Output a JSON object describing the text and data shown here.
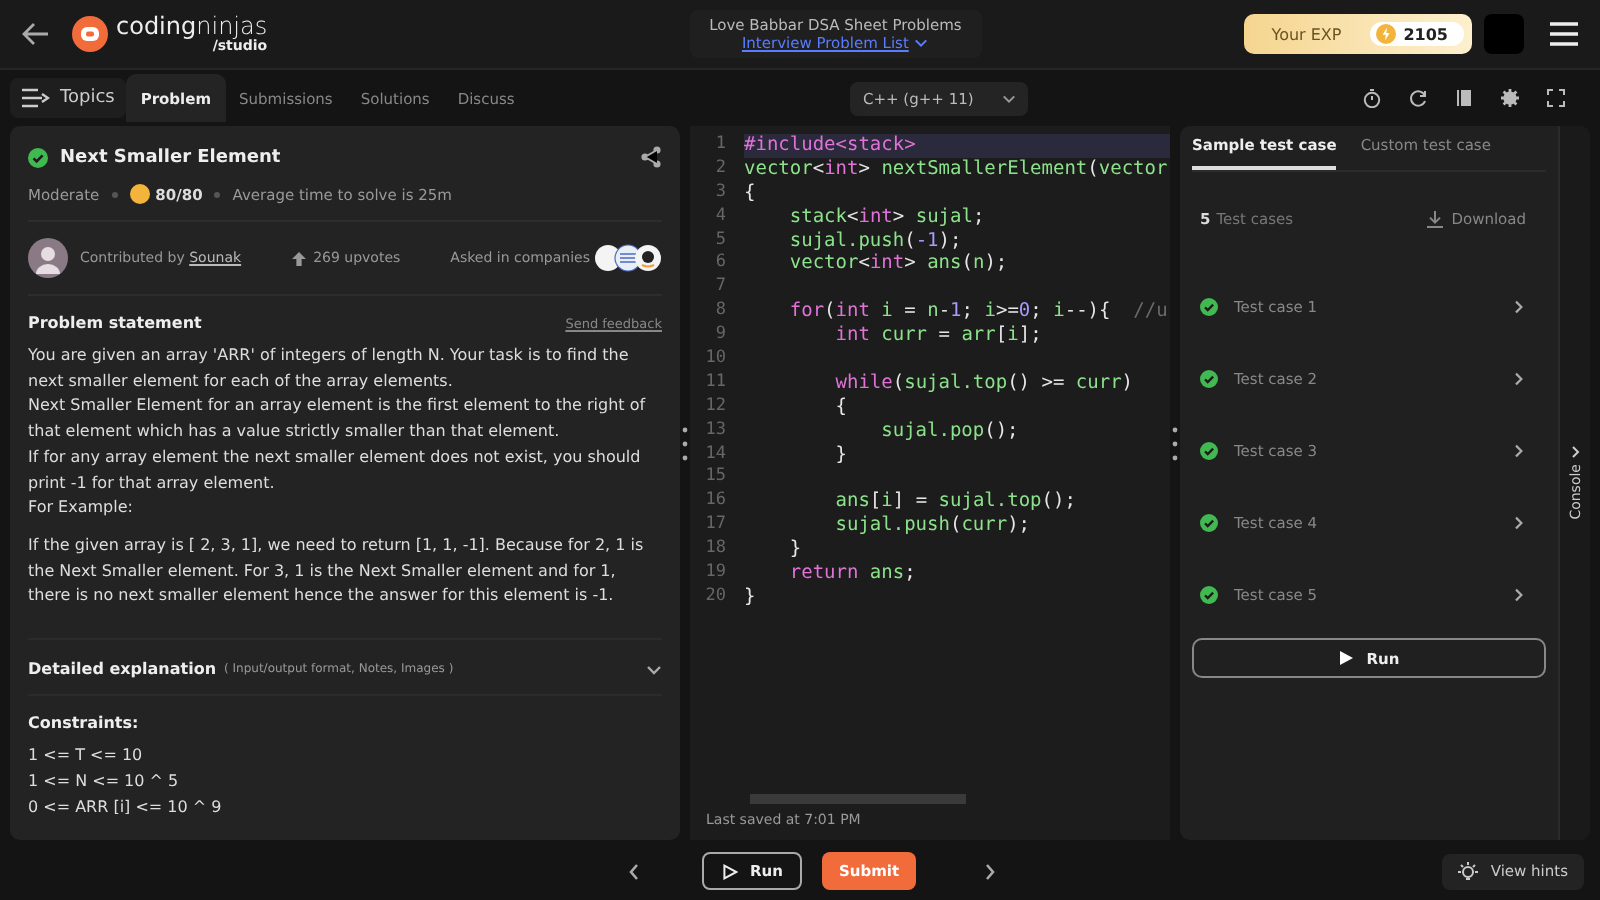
{
  "header": {
    "logo_text": "**coding**ninjas",
    "logo_sub": "/studio",
    "sheet_title": "Love Babbar DSA Sheet Problems",
    "sheet_link": "Interview Problem List",
    "exp_label": "Your EXP",
    "exp_value": "2105"
  },
  "topics_button": "Topics",
  "tabs": [
    {
      "label": "Problem",
      "selected": true
    },
    {
      "label": "Submissions",
      "selected": false
    },
    {
      "label": "Solutions",
      "selected": false
    },
    {
      "label": "Discuss",
      "selected": false
    }
  ],
  "language": "C++ (g++ 11)",
  "problem": {
    "solved": true,
    "title": "Next Smaller Element",
    "difficulty": "Moderate",
    "score": "80/80",
    "avg_time": "Average time to solve is 25m",
    "contributor_prefix": "Contributed by",
    "contributor": "Sounak",
    "upvotes": "269 upvotes",
    "companies_label": "Asked in companies",
    "statement_heading": "Problem statement",
    "feedback": "Send feedback",
    "paragraphs": [
      "You are given an array 'ARR' of integers of length N. Your task is to find the next smaller element for each of the array elements.",
      "Next Smaller Element for an array element is the first element to the right of that element which has a value strictly smaller than that element.",
      "If for any array element the next smaller element does not exist, you should print -1 for that array element.",
      "For Example:"
    ],
    "example": "If the given array is [ 2, 3, 1], we need to return [1, 1, -1]. Because for 2, 1 is the Next Smaller element. For 3, 1 is the Next Smaller element and for 1, there is no next smaller element hence the answer for this element is -1.",
    "explanation_heading": "Detailed explanation",
    "explanation_note": "( Input/output format, Notes, Images )",
    "constraints_heading": "Constraints:",
    "constraints": [
      "1 <= T <= 10",
      "1 <= N <= 10 ^ 5",
      "0 <= ARR [i] <= 10 ^ 9"
    ]
  },
  "code": [
    {
      "num": "1",
      "selected": true,
      "tokens": [
        {
          "kind": "keyword",
          "text": "#include<stack>"
        }
      ]
    },
    {
      "num": "2",
      "selected": false,
      "tokens": [
        {
          "kind": "ident",
          "text": "vector"
        },
        {
          "kind": "punct",
          "text": "<"
        },
        {
          "kind": "keyword",
          "text": "int"
        },
        {
          "kind": "punct",
          "text": "> "
        },
        {
          "kind": "ident",
          "text": "nextSmallerElement"
        },
        {
          "kind": "punct",
          "text": "("
        },
        {
          "kind": "ident",
          "text": "vector"
        }
      ]
    },
    {
      "num": "3",
      "selected": false,
      "tokens": [
        {
          "kind": "punct",
          "text": "{"
        }
      ]
    },
    {
      "num": "4",
      "selected": false,
      "tokens": [
        {
          "kind": "ident",
          "text": "    stack"
        },
        {
          "kind": "punct",
          "text": "<"
        },
        {
          "kind": "keyword",
          "text": "int"
        },
        {
          "kind": "punct",
          "text": "> "
        },
        {
          "kind": "ident",
          "text": "sujal"
        },
        {
          "kind": "punct",
          "text": ";"
        }
      ]
    },
    {
      "num": "5",
      "selected": false,
      "tokens": [
        {
          "kind": "ident",
          "text": "    sujal.push"
        },
        {
          "kind": "punct",
          "text": "("
        },
        {
          "kind": "number",
          "text": "-1"
        },
        {
          "kind": "punct",
          "text": ");"
        }
      ]
    },
    {
      "num": "6",
      "selected": false,
      "tokens": [
        {
          "kind": "ident",
          "text": "    vector"
        },
        {
          "kind": "punct",
          "text": "<"
        },
        {
          "kind": "keyword",
          "text": "int"
        },
        {
          "kind": "punct",
          "text": "> "
        },
        {
          "kind": "ident",
          "text": "ans"
        },
        {
          "kind": "punct",
          "text": "("
        },
        {
          "kind": "ident",
          "text": "n"
        },
        {
          "kind": "punct",
          "text": ");"
        }
      ]
    },
    {
      "num": "7",
      "selected": false
    },
    {
      "num": "8",
      "selected": false,
      "tokens": [
        {
          "kind": "keyword",
          "text": "    for"
        },
        {
          "kind": "punct",
          "text": "("
        },
        {
          "kind": "keyword",
          "text": "int"
        },
        {
          "kind": "ident",
          "text": " i "
        },
        {
          "kind": "punct",
          "text": "= "
        },
        {
          "kind": "ident",
          "text": "n"
        },
        {
          "kind": "punct",
          "text": "-"
        },
        {
          "kind": "number",
          "text": "1"
        },
        {
          "kind": "punct",
          "text": "; "
        },
        {
          "kind": "ident",
          "text": "i"
        },
        {
          "kind": "punct",
          "text": ">="
        },
        {
          "kind": "number",
          "text": "0"
        },
        {
          "kind": "punct",
          "text": "; "
        },
        {
          "kind": "ident",
          "text": "i"
        },
        {
          "kind": "punct",
          "text": "--){  "
        },
        {
          "kind": "comment",
          "text": "//u"
        }
      ]
    },
    {
      "num": "9",
      "selected": false,
      "tokens": [
        {
          "kind": "keyword",
          "text": "        int"
        },
        {
          "kind": "ident",
          "text": " curr "
        },
        {
          "kind": "punct",
          "text": "= "
        },
        {
          "kind": "ident",
          "text": "arr"
        },
        {
          "kind": "punct",
          "text": "["
        },
        {
          "kind": "ident",
          "text": "i"
        },
        {
          "kind": "punct",
          "text": "];"
        }
      ]
    },
    {
      "num": "10",
      "selected": false
    },
    {
      "num": "11",
      "selected": false,
      "tokens": [
        {
          "kind": "keyword",
          "text": "        while"
        },
        {
          "kind": "punct",
          "text": "("
        },
        {
          "kind": "ident",
          "text": "sujal.top"
        },
        {
          "kind": "punct",
          "text": "() >= "
        },
        {
          "kind": "ident",
          "text": "curr"
        },
        {
          "kind": "punct",
          "text": ")"
        }
      ]
    },
    {
      "num": "12",
      "selected": false,
      "tokens": [
        {
          "kind": "punct",
          "text": "        {"
        }
      ]
    },
    {
      "num": "13",
      "selected": false,
      "tokens": [
        {
          "kind": "ident",
          "text": "            sujal.pop"
        },
        {
          "kind": "punct",
          "text": "();"
        }
      ]
    },
    {
      "num": "14",
      "selected": false,
      "tokens": [
        {
          "kind": "punct",
          "text": "        }"
        }
      ]
    },
    {
      "num": "15",
      "selected": false
    },
    {
      "num": "16",
      "selected": false,
      "tokens": [
        {
          "kind": "ident",
          "text": "        ans"
        },
        {
          "kind": "punct",
          "text": "["
        },
        {
          "kind": "ident",
          "text": "i"
        },
        {
          "kind": "punct",
          "text": "] = "
        },
        {
          "kind": "ident",
          "text": "sujal.top"
        },
        {
          "kind": "punct",
          "text": "();"
        }
      ]
    },
    {
      "num": "17",
      "selected": false,
      "tokens": [
        {
          "kind": "ident",
          "text": "        sujal.push"
        },
        {
          "kind": "punct",
          "text": "("
        },
        {
          "kind": "ident",
          "text": "curr"
        },
        {
          "kind": "punct",
          "text": ");"
        }
      ]
    },
    {
      "num": "18",
      "selected": false,
      "tokens": [
        {
          "kind": "punct",
          "text": "    }"
        }
      ]
    },
    {
      "num": "19",
      "selected": false,
      "tokens": [
        {
          "kind": "keyword",
          "text": "    return"
        },
        {
          "kind": "ident",
          "text": " ans"
        },
        {
          "kind": "punct",
          "text": ";"
        }
      ]
    },
    {
      "num": "20",
      "selected": false,
      "tokens": [
        {
          "kind": "punct",
          "text": "}"
        }
      ]
    }
  ],
  "last_saved": "Last saved at 7:01 PM",
  "test_tabs": [
    {
      "label": "Sample test case",
      "selected": true
    },
    {
      "label": "Custom test case",
      "selected": false
    }
  ],
  "test_count": "5",
  "test_count_label": "Test cases",
  "download": "Download",
  "test_cases": [
    {
      "label": "Test case 1",
      "passed": true
    },
    {
      "label": "Test case 2",
      "passed": true
    },
    {
      "label": "Test case 3",
      "passed": true
    },
    {
      "label": "Test case 4",
      "passed": true
    },
    {
      "label": "Test case 5",
      "passed": true
    }
  ],
  "panel_run": "Run",
  "console": "Console",
  "footer": {
    "run": "Run",
    "submit": "Submit",
    "hints": "View hints"
  }
}
